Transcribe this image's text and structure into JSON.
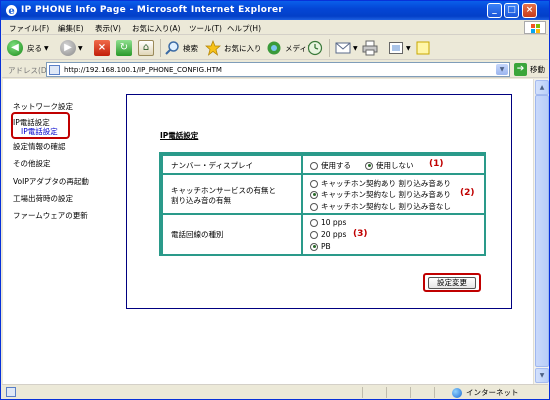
{
  "window": {
    "title": "IP PHONE Info Page - Microsoft Internet Explorer"
  },
  "menu": [
    "ファイル(F)",
    "編集(E)",
    "表示(V)",
    "お気に入り(A)",
    "ツール(T)",
    "ヘルプ(H)"
  ],
  "toolbar": {
    "back": "戻る",
    "search": "検索",
    "favorites": "お気に入り",
    "media": "メディア"
  },
  "address": {
    "label": "アドレス(D)",
    "url": "http://192.168.100.1/IP_PHONE_CONFIG.HTM",
    "go": "移動"
  },
  "nav": [
    {
      "label": "ネットワーク設定"
    },
    {
      "label": "IP電話設定"
    },
    {
      "label": "IP電話設定",
      "sub": true
    },
    {
      "label": "設定情報の確認"
    },
    {
      "label": "その他設定"
    },
    {
      "label": "VoIPアダプタの再起動"
    },
    {
      "label": "工場出荷時の設定"
    },
    {
      "label": "ファームウェアの更新"
    }
  ],
  "panel": {
    "title": "IP電話設定",
    "rows": [
      {
        "label": [
          "ナンバー・ディスプレイ"
        ],
        "options": [
          "使用する",
          "使用しない"
        ],
        "selected": 1,
        "marker": "(1)"
      },
      {
        "label": [
          "キャッチホンサービスの有無と",
          "割り込み音の有無"
        ],
        "options": [
          "キャッチホン契約あり 割り込み音あり",
          "キャッチホン契約なし 割り込み音あり",
          "キャッチホン契約なし 割り込み音なし"
        ],
        "selected": 1,
        "marker": "(2)"
      },
      {
        "label": [
          "電話回線の種別"
        ],
        "options": [
          "10 pps",
          "20 pps",
          "PB"
        ],
        "selected": 2,
        "marker": "(3)"
      }
    ],
    "apply": "設定変更"
  },
  "status": {
    "zone": "インターネット"
  },
  "colors": {
    "accent_red": "#c00000",
    "table_border": "#2a9a8a",
    "panel_border": "#000080"
  }
}
